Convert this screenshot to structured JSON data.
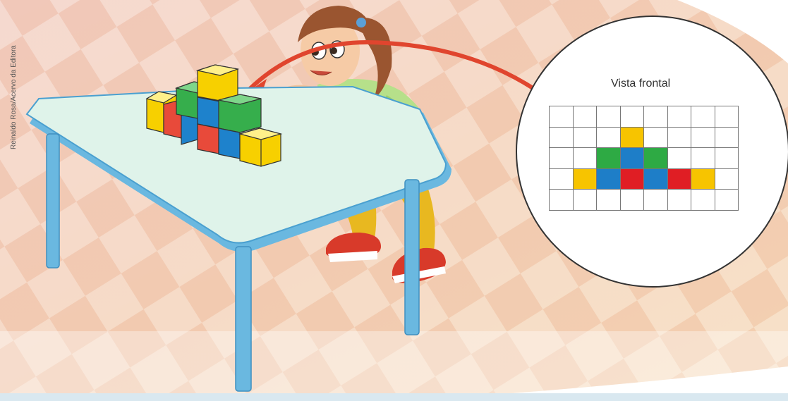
{
  "credit": "Reinaldo Rosa/Acervo da Editora",
  "front_view": {
    "label": "Vista frontal",
    "colors": {
      "Y": "#f7c400",
      "G": "#2eaa44",
      "B": "#1e7ec8",
      "R": "#e01e24",
      ".": "#ffffff"
    },
    "rows": [
      "........",
      "...Y....",
      "..GBG...",
      ".YBRBRY.",
      "........"
    ]
  }
}
